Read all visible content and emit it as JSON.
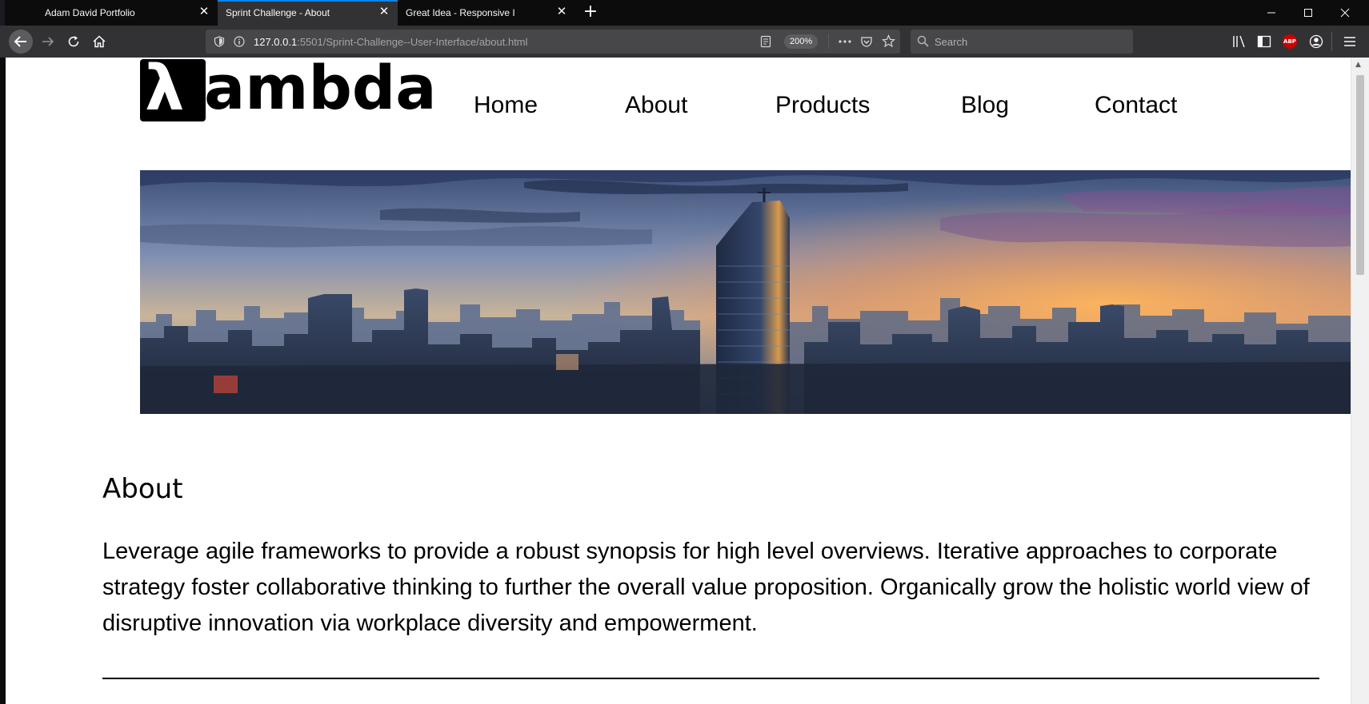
{
  "browser": {
    "tabs": [
      {
        "title": "Adam David Portfolio",
        "selected": false
      },
      {
        "title": "Sprint Challenge - About",
        "selected": true
      },
      {
        "title": "Great Idea - Responsive I",
        "selected": false
      }
    ],
    "new_tab_glyph": "+",
    "window_controls": {
      "minimize": "—",
      "maximize": "☐",
      "close": "✕"
    },
    "url_host": "127.0.0.1",
    "url_rest": ":5501/Sprint-Challenge--User-Interface/about.html",
    "zoom": "200%",
    "search_placeholder": "Search",
    "accent_color": "#0a84ff",
    "adblock_badge": "ABP"
  },
  "site": {
    "logo": {
      "symbol": "λ",
      "text": "ambda"
    },
    "nav": [
      "Home",
      "About",
      "Products",
      "Blog",
      "Contact"
    ],
    "about": {
      "heading": "About",
      "body": "Leverage agile frameworks to provide a robust synopsis for high level overviews. Iterative approaches to corporate strategy foster collaborative thinking to further the overall value proposition. Organically grow the holistic world view of disruptive innovation via workplace diversity and empowerment."
    }
  }
}
